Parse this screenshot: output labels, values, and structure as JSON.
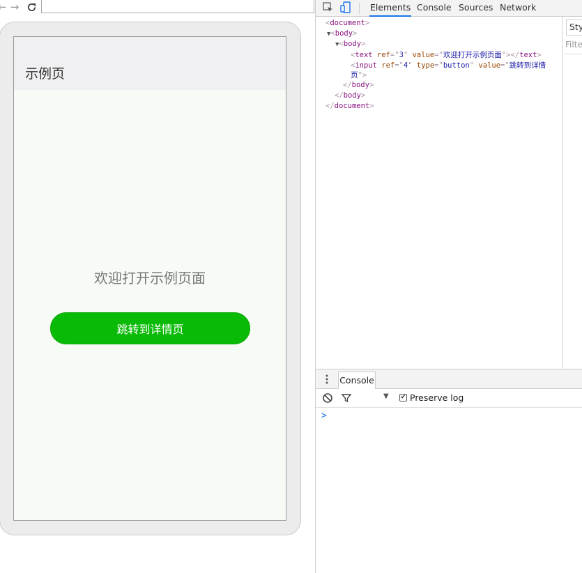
{
  "browser": {
    "back_icon": "arrow-left-icon",
    "forward_icon": "arrow-right-icon",
    "reload_icon": "reload-icon",
    "address_value": ""
  },
  "app": {
    "title": "示例页",
    "welcome_text": "欢迎打开示例页面",
    "button_label": "跳转到详情页",
    "button_color": "#09bb07",
    "background_color": "#f6fbf6"
  },
  "devtools": {
    "tabs": [
      "Elements",
      "Console",
      "Sources",
      "Network"
    ],
    "active_tab": "Elements",
    "inspect_icon": "inspect-element-icon",
    "device_icon": "device-toolbar-icon",
    "tree": {
      "document_open": "document",
      "body_outer": "body",
      "body_inner": "body",
      "text_tag": "text",
      "text_ref_attr": "ref",
      "text_ref_val": "3",
      "text_value_attr": "value",
      "text_value_val": "欢迎打开示例页面",
      "input_tag": "input",
      "input_ref_attr": "ref",
      "input_ref_val": "4",
      "input_type_attr": "type",
      "input_type_val": "button",
      "input_value_attr": "value",
      "input_value_val_line1": "跳转到详情",
      "input_value_val_line2": "页",
      "body_inner_close": "body",
      "body_outer_close": "body",
      "document_close": "document"
    },
    "styles": {
      "tab_label": "Sty",
      "filter_placeholder": "Filte"
    },
    "drawer": {
      "tab_label": "Console",
      "preserve_log_label": "Preserve log",
      "preserve_log_checked": true,
      "prompt": ">"
    }
  }
}
